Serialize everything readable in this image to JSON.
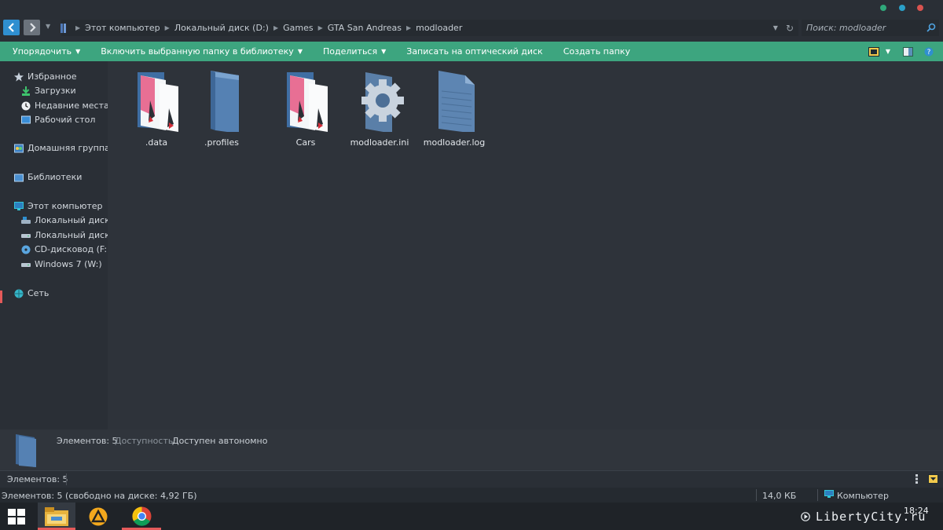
{
  "addressbar": {
    "crumbs": [
      "Этот компьютер",
      "Локальный диск (D:)",
      "Games",
      "GTA San Andreas",
      "modloader"
    ],
    "search_placeholder": "Поиск: modloader"
  },
  "toolbar": {
    "organize": "Упорядочить",
    "include_library": "Включить выбранную папку в библиотеку",
    "share": "Поделиться",
    "burn": "Записать на оптический диск",
    "new_folder": "Создать папку"
  },
  "sidebar": {
    "favorites": "Избранное",
    "downloads": "Загрузки",
    "recent": "Недавние места",
    "desktop": "Рабочий стол",
    "homegroup": "Домашняя группа",
    "libraries": "Библиотеки",
    "computer": "Этот компьютер",
    "drive_c": "Локальный диск (C",
    "drive_d": "Локальный диск (D",
    "drive_f": "CD-дисковод (F:)",
    "drive_w": "Windows 7 (W:)",
    "network": "Сеть"
  },
  "files": [
    {
      "name": ".data",
      "icon": "documents-folder-icon"
    },
    {
      "name": ".profiles",
      "icon": "folder-icon"
    },
    {
      "name": "Cars",
      "icon": "documents-folder-icon"
    },
    {
      "name": "modloader.ini",
      "icon": "settings-file-icon"
    },
    {
      "name": "modloader.log",
      "icon": "text-file-icon"
    }
  ],
  "details": {
    "items_label": "Элементов: 5",
    "availability_label": "Доступность:",
    "availability_value": "Доступен автономно"
  },
  "status": {
    "items": "Элементов: 5",
    "free_space": "Элементов: 5 (свободно на диске: 4,92 ГБ)",
    "size": "14,0 КБ",
    "location": "Компьютер"
  },
  "taskbar": {
    "time": "18:24",
    "watermark": "LibertyCity.ru"
  },
  "colors": {
    "accent": "#3da57f",
    "window_bg": "#2e333a",
    "dot_green": "#2fa87a",
    "dot_teal": "#2aa0c8",
    "dot_red": "#d9534f"
  }
}
